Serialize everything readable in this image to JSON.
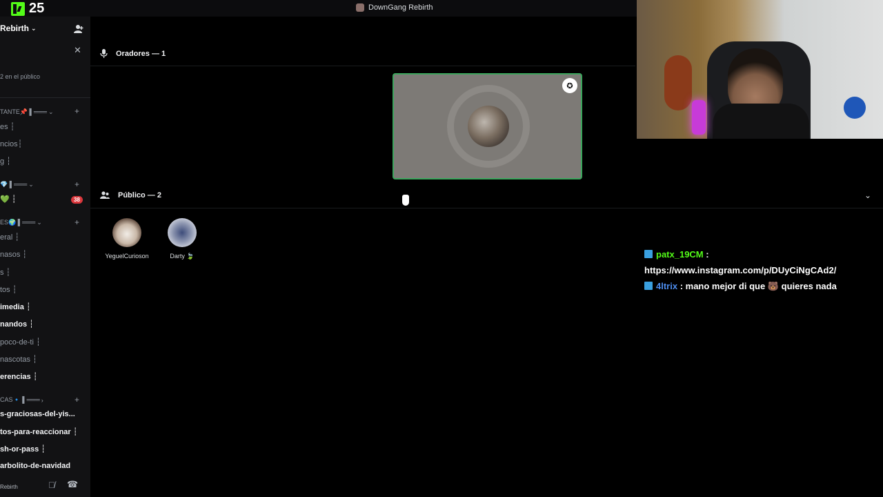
{
  "topbar": {
    "viewer_count": "25",
    "window_title": "DownGang Rebirth"
  },
  "sidebar": {
    "server_name": "Rebirth",
    "audience_note": "2 en el público",
    "categories": [
      {
        "label": "TANTE📌 ▌═══"
      },
      {
        "label": "💎 ▌═══"
      },
      {
        "label": "ES🌍 ▌═══"
      },
      {
        "label": "CAS🔹 ▌═══"
      }
    ],
    "channels": [
      {
        "label": "es ┆"
      },
      {
        "label": "ncios┆"
      },
      {
        "label": "g ┆"
      },
      {
        "label": "💚 ┆"
      },
      {
        "label": "eral ┆"
      },
      {
        "label": "nasos ┆"
      },
      {
        "label": "s ┆"
      },
      {
        "label": "tos ┆"
      },
      {
        "label": "imedia ┆"
      },
      {
        "label": "nandos ┆"
      },
      {
        "label": "poco-de-ti ┆"
      },
      {
        "label": "nascotas ┆"
      },
      {
        "label": "erencias ┆"
      },
      {
        "label": "s-graciosas-del-yis..."
      },
      {
        "label": "tos-para-reaccionar ┆"
      },
      {
        "label": "sh-or-pass ┆"
      },
      {
        "label": "arbolito-de-navidad"
      }
    ],
    "mention_badge": "38",
    "user_panel_name": "Rebirth"
  },
  "stage": {
    "speakers_header": "Oradores — 1",
    "audience_header": "Público — 2",
    "audience": [
      {
        "name": "YeguelCurioson"
      },
      {
        "name": "Darty 🍃"
      }
    ]
  },
  "chat": [
    {
      "user": "patx_19CM",
      "sep": " :",
      "message": "https://www.instagram.com/p/DUyCiNgCAd2/"
    },
    {
      "user": "4ltrix",
      "sep": " : ",
      "message": "mano mejor di que 🐻 quieres nada"
    }
  ],
  "colors": {
    "kick_green": "#53fc18",
    "speaking_border": "#3ba55c",
    "mention_red": "#da373c",
    "chat_user2": "#4d8ef0"
  },
  "icons": [
    "kick-logo-icon",
    "chevron-down-icon",
    "add-member-icon",
    "close-icon",
    "microphone-icon",
    "audience-icon",
    "moderator-badge-icon",
    "mute-icon",
    "hangup-icon",
    "subscriber-icon"
  ]
}
